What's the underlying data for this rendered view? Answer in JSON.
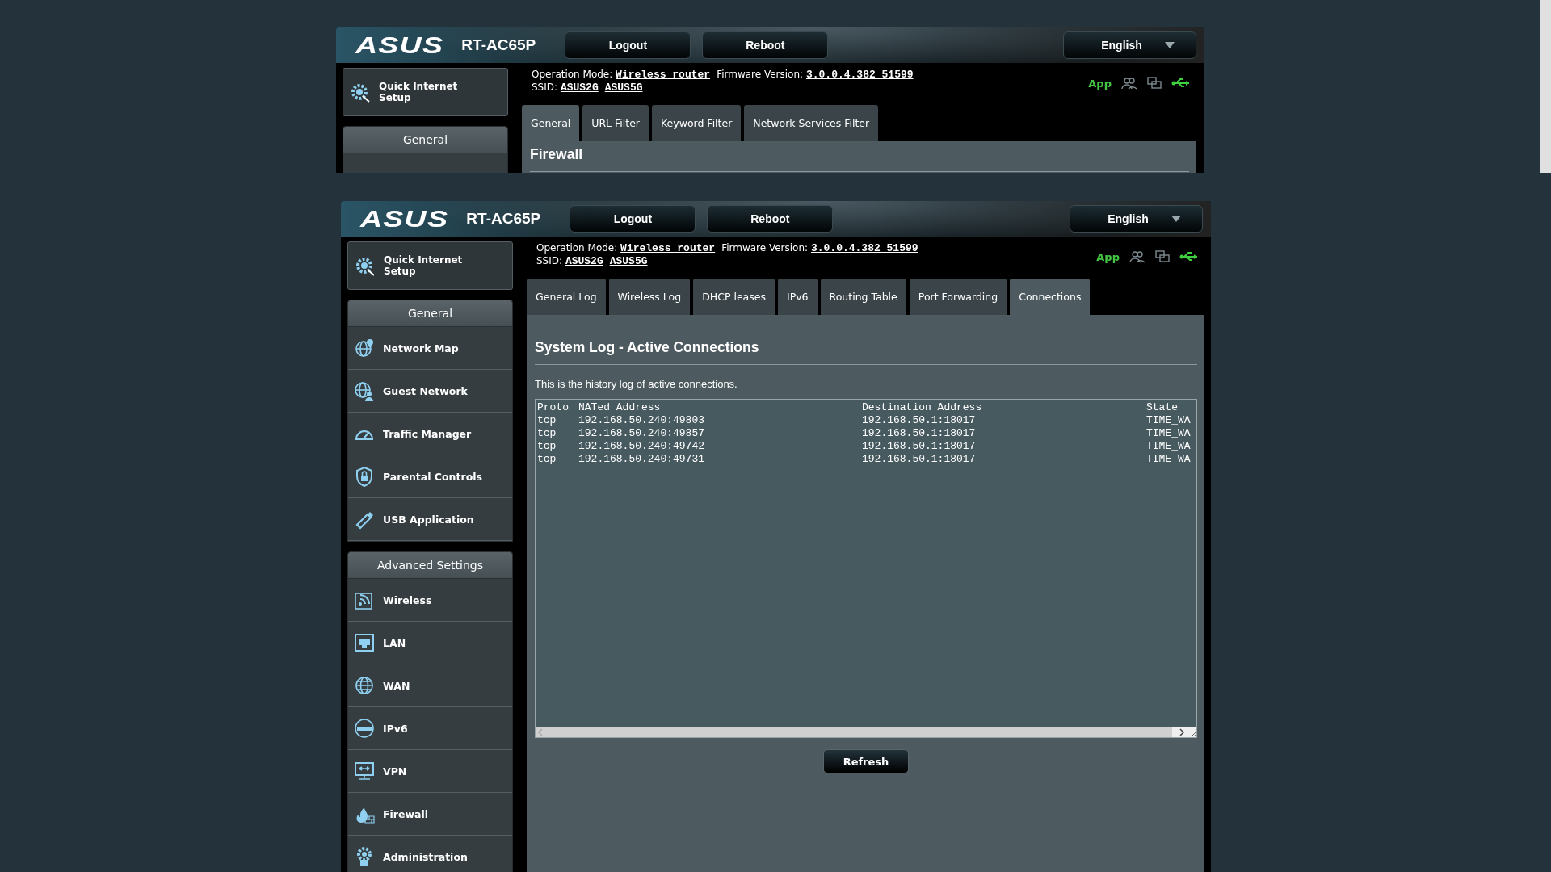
{
  "windows": [
    {
      "brand": "ASUS",
      "model": "RT-AC65P",
      "buttons": [
        "Logout",
        "Reboot"
      ],
      "language": "English",
      "operation_mode": {
        "label": "Operation Mode:",
        "value": "Wireless router"
      },
      "firmware": {
        "label": "Firmware Version:",
        "value": "3.0.0.4.382_51599"
      },
      "ssid": {
        "label": "SSID:",
        "values": [
          "ASUS2G",
          "ASUS5G"
        ]
      },
      "app_label": "App",
      "tabs": [
        {
          "label": "General",
          "selected": true
        },
        {
          "label": "URL Filter",
          "selected": false
        },
        {
          "label": "Keyword Filter",
          "selected": false
        },
        {
          "label": "Network Services Filter",
          "selected": false
        }
      ],
      "sidebar": {
        "quick_setup": "Quick Internet Setup",
        "sections": [
          {
            "heading": "General"
          }
        ]
      },
      "content": {
        "title": "Firewall"
      }
    },
    {
      "brand": "ASUS",
      "model": "RT-AC65P",
      "buttons": [
        "Logout",
        "Reboot"
      ],
      "language": "English",
      "operation_mode": {
        "label": "Operation Mode:",
        "value": "Wireless router"
      },
      "firmware": {
        "label": "Firmware Version:",
        "value": "3.0.0.4.382_51599"
      },
      "ssid": {
        "label": "SSID:",
        "values": [
          "ASUS2G",
          "ASUS5G"
        ]
      },
      "app_label": "App",
      "tabs": [
        {
          "label": "General Log",
          "selected": false
        },
        {
          "label": "Wireless Log",
          "selected": false
        },
        {
          "label": "DHCP leases",
          "selected": false
        },
        {
          "label": "IPv6",
          "selected": false
        },
        {
          "label": "Routing Table",
          "selected": false
        },
        {
          "label": "Port Forwarding",
          "selected": false
        },
        {
          "label": "Connections",
          "selected": true
        }
      ],
      "sidebar": {
        "quick_setup": "Quick Internet Setup",
        "sections": [
          {
            "heading": "General",
            "items": [
              "Network Map",
              "Guest Network",
              "Traffic Manager",
              "Parental Controls",
              "USB Application"
            ]
          },
          {
            "heading": "Advanced Settings",
            "items": [
              "Wireless",
              "LAN",
              "WAN",
              "IPv6",
              "VPN",
              "Firewall",
              "Administration"
            ]
          }
        ]
      },
      "content": {
        "title": "System Log - Active Connections",
        "description": "This is the history log of active connections.",
        "log": {
          "columns": [
            "Proto",
            "NATed Address",
            "Destination Address",
            "State"
          ],
          "rows": [
            [
              "tcp",
              "192.168.50.240:49803",
              "192.168.50.1:18017",
              "TIME_WA"
            ],
            [
              "tcp",
              "192.168.50.240:49857",
              "192.168.50.1:18017",
              "TIME_WA"
            ],
            [
              "tcp",
              "192.168.50.240:49742",
              "192.168.50.1:18017",
              "TIME_WA"
            ],
            [
              "tcp",
              "192.168.50.240:49731",
              "192.168.50.1:18017",
              "TIME_WA"
            ]
          ]
        },
        "button": "Refresh"
      }
    }
  ]
}
